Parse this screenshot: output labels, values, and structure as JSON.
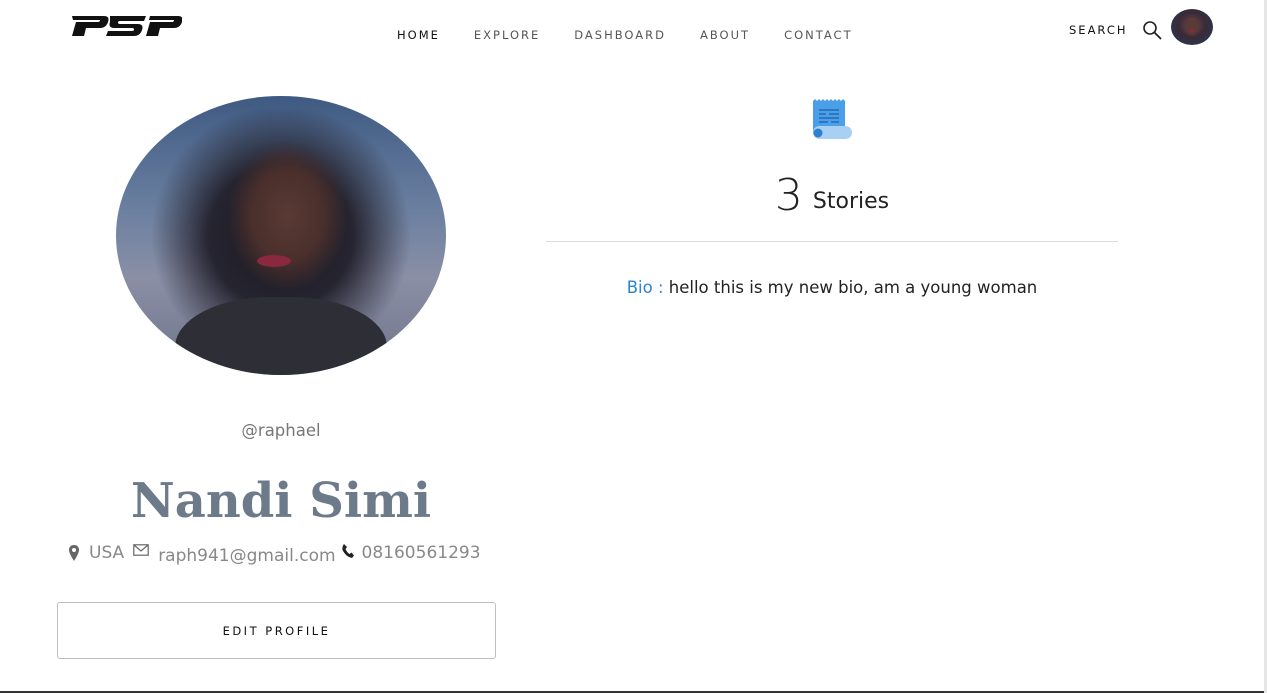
{
  "header": {
    "logo_text": "PSP",
    "nav": [
      {
        "label": "HOME",
        "active": true
      },
      {
        "label": "EXPLORE",
        "active": false
      },
      {
        "label": "DASHBOARD",
        "active": false
      },
      {
        "label": "ABOUT",
        "active": false
      },
      {
        "label": "CONTACT",
        "active": false
      }
    ],
    "search_label": "SEARCH",
    "icons": {
      "search": "search-icon",
      "avatar": "user-avatar"
    }
  },
  "profile": {
    "username": "@raphael",
    "full_name": "Nandi Simi",
    "location": "USA",
    "email": "raph941@gmail.com",
    "phone": "08160561293",
    "edit_button": "EDIT PROFILE",
    "icons": {
      "location": "map-pin-icon",
      "email": "envelope-icon",
      "phone": "phone-icon"
    }
  },
  "stats": {
    "stories_count": "3",
    "stories_label": "Stories",
    "icon": "scroll-document-icon"
  },
  "bio": {
    "label": "Bio :",
    "text": "hello this is my new bio, am a young woman"
  },
  "colors": {
    "accent": "#2a86d4",
    "name_color": "#6c7a8a",
    "icon_blue": "#4a9fe8"
  }
}
